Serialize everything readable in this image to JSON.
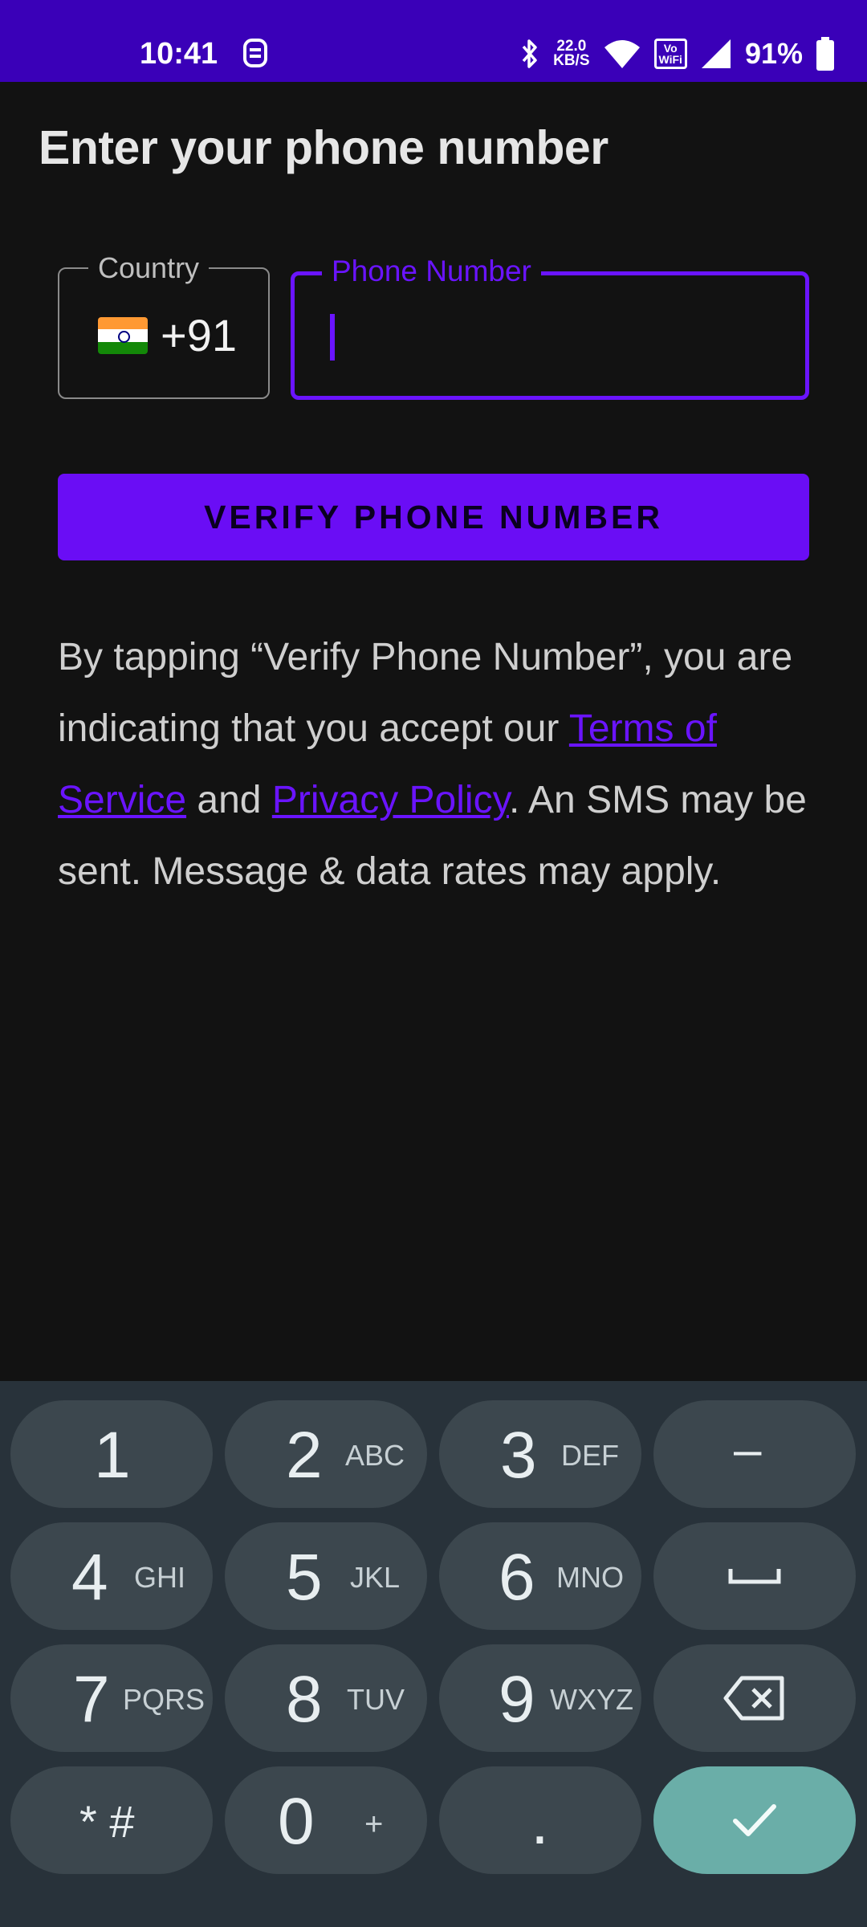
{
  "status_bar": {
    "time": "10:41",
    "net_speed_value": "22.0",
    "net_speed_unit": "KB/S",
    "vowifi_top": "Vo",
    "vowifi_bottom": "WiFi",
    "battery": "91%",
    "icons": [
      "nfc-icon",
      "bluetooth-icon",
      "wifi-icon",
      "vowifi-icon",
      "cell-signal-icon",
      "battery-icon"
    ]
  },
  "page": {
    "title": "Enter your phone number"
  },
  "country": {
    "label": "Country",
    "flag": "india-flag",
    "code": "+91"
  },
  "phone": {
    "label": "Phone Number",
    "value": ""
  },
  "verify_button": {
    "label": "VERIFY PHONE NUMBER"
  },
  "legal": {
    "text_1": "By tapping “Verify Phone Number”, you are indicating that you accept our ",
    "terms_link": "Terms of Service",
    "text_2": " and ",
    "privacy_link": "Privacy Policy",
    "text_3": ". An SMS may be sent. Message & data rates may apply."
  },
  "keyboard": {
    "keys": [
      {
        "digit": "1",
        "letters": ""
      },
      {
        "digit": "2",
        "letters": "ABC"
      },
      {
        "digit": "3",
        "letters": "DEF"
      },
      {
        "digit": "4",
        "letters": "GHI"
      },
      {
        "digit": "5",
        "letters": "JKL"
      },
      {
        "digit": "6",
        "letters": "MNO"
      },
      {
        "digit": "7",
        "letters": "PQRS"
      },
      {
        "digit": "8",
        "letters": "TUV"
      },
      {
        "digit": "9",
        "letters": "WXYZ"
      },
      {
        "digit": "* #",
        "letters": ""
      },
      {
        "digit": "0",
        "letters": "+"
      },
      {
        "digit": ".",
        "letters": ""
      }
    ],
    "minus_key": "–",
    "icons": [
      "space-icon",
      "backspace-icon",
      "checkmark-icon"
    ]
  },
  "colors": {
    "status_bar": "#3a00b8",
    "accent": "#6a14ff",
    "background": "#121212",
    "keyboard_bg": "#28323a",
    "key_bg": "#3c474e",
    "done_key": "#6aaea8"
  }
}
